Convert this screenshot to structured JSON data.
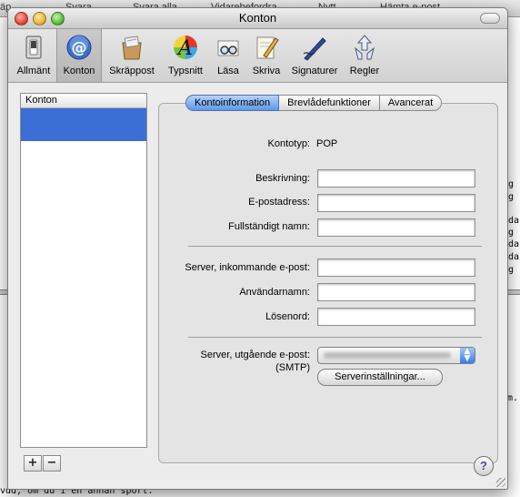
{
  "background": {
    "toolbar_items": [
      "Svara",
      "Svara alla",
      "Vidarebefordra",
      "Nytt",
      "Hämta e-post"
    ],
    "fragment_left": "äp",
    "text_fragment_1": "vdd, om du i en annan sport.",
    "text_fragment_2": "um.",
    "right_fragments": [
      "ag",
      "ag",
      "g",
      "nda",
      "ag",
      "nda",
      "nda",
      "ag"
    ]
  },
  "window": {
    "title": "Konton"
  },
  "toolbar": {
    "items": [
      {
        "label": "Allmänt",
        "icon": "switch-icon"
      },
      {
        "label": "Konton",
        "icon": "at-sign-icon",
        "selected": true
      },
      {
        "label": "Skräppost",
        "icon": "junk-mail-icon"
      },
      {
        "label": "Typsnitt",
        "icon": "font-icon"
      },
      {
        "label": "Läsa",
        "icon": "glasses-icon"
      },
      {
        "label": "Skriva",
        "icon": "pencil-icon"
      },
      {
        "label": "Signaturer",
        "icon": "pen-icon"
      },
      {
        "label": "Regler",
        "icon": "rules-icon"
      }
    ]
  },
  "accounts": {
    "header": "Konton",
    "add_label": "+",
    "remove_label": "−"
  },
  "tabs": [
    {
      "label": "Kontoinformation",
      "active": true
    },
    {
      "label": "Brevlådefunktioner"
    },
    {
      "label": "Avancerat"
    }
  ],
  "form": {
    "account_type_label": "Kontotyp:",
    "account_type_value": "POP",
    "description_label": "Beskrivning:",
    "email_label": "E-postadress:",
    "full_name_label": "Fullständigt namn:",
    "incoming_server_label": "Server, inkommande e-post:",
    "username_label": "Användarnamn:",
    "password_label": "Lösenord:",
    "outgoing_server_label": "Server, utgående e-post:",
    "outgoing_server_sub": "(SMTP)",
    "server_settings_button": "Serverinställningar..."
  },
  "help": {
    "label": "?"
  },
  "colors": {
    "selection": "#3b6fd6",
    "tab_active": "#5c98e8",
    "window_bg": "#ececec"
  }
}
